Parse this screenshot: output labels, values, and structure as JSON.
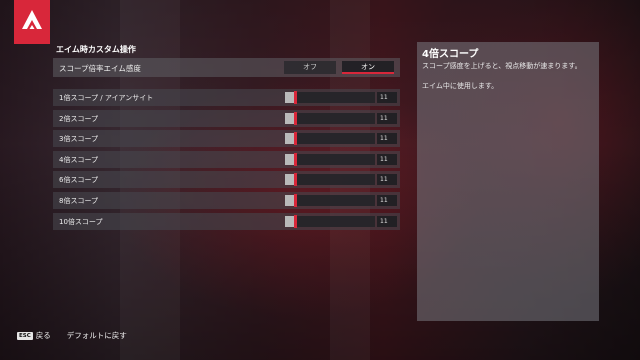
{
  "brand": {
    "accent": "#d8273a",
    "logo_icon": "apex-logo-icon"
  },
  "section": {
    "title": "エイム時カスタム操作"
  },
  "toggle": {
    "label": "スコープ倍率エイム感度",
    "options": [
      "オフ",
      "オン"
    ],
    "selected": "オン"
  },
  "sliders": [
    {
      "label": "1倍スコープ / アイアンサイト",
      "value": "11",
      "fill": 0.1
    },
    {
      "label": "2倍スコープ",
      "value": "11",
      "fill": 0.1
    },
    {
      "label": "3倍スコープ",
      "value": "11",
      "fill": 0.1
    },
    {
      "label": "4倍スコープ",
      "value": "11",
      "fill": 0.1
    },
    {
      "label": "6倍スコープ",
      "value": "11",
      "fill": 0.1
    },
    {
      "label": "8倍スコープ",
      "value": "11",
      "fill": 0.1
    },
    {
      "label": "10倍スコープ",
      "value": "11",
      "fill": 0.1
    }
  ],
  "info": {
    "title": "4倍スコープ",
    "line1": "スコープ感度を上げると、視点移動が速まります。",
    "line2": "エイム中に使用します。"
  },
  "footer": {
    "back_key": "ESC",
    "back_label": "戻る",
    "reset_label": "デフォルトに戻す"
  }
}
